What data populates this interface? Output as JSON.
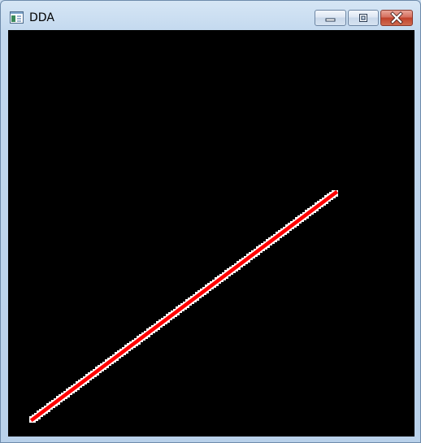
{
  "window": {
    "title": "DDA"
  },
  "icons": {
    "app": "window-app-icon",
    "minimize": "minimize-icon",
    "maximize": "maximize-icon",
    "close": "close-icon"
  },
  "canvas": {
    "background": "#000000",
    "line_color": "#ff0000",
    "line_outline_color": "#ffffff"
  }
}
